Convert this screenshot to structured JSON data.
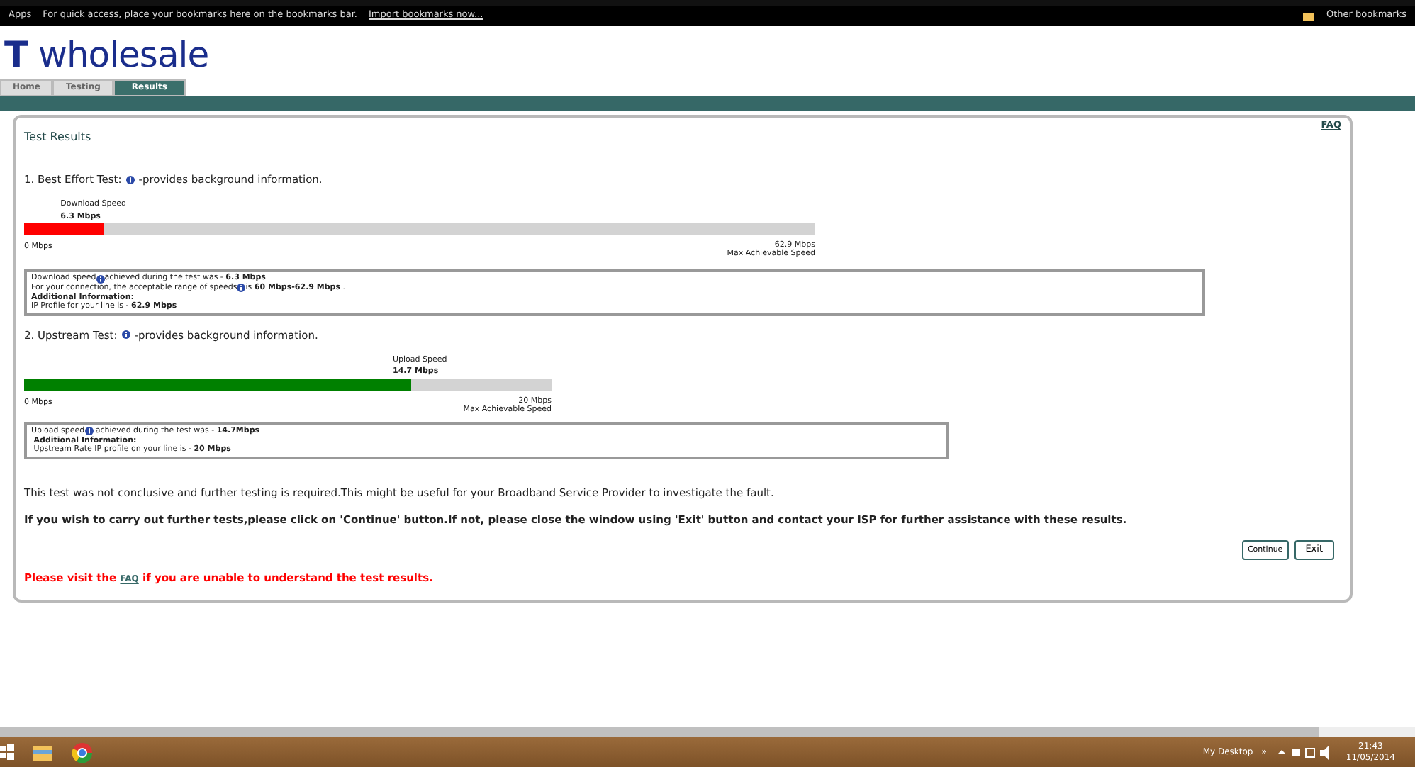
{
  "bookmarks_bar": {
    "apps": "Apps",
    "hint": "For quick access, place your bookmarks here on the bookmarks bar.",
    "import_link": "Import bookmarks now...",
    "other": "Other bookmarks"
  },
  "logo": {
    "text": "**T** wholesale"
  },
  "tabs": [
    {
      "label": "Home",
      "selected": false
    },
    {
      "label": "Testing",
      "selected": false
    },
    {
      "label": "Results",
      "selected": true
    }
  ],
  "panel": {
    "title": "Test Results",
    "faq_link": "FAQ",
    "tests": [
      {
        "heading": "1. Best Effort Test:",
        "info": "-provides background information.",
        "speed_label": "Download Speed",
        "speed": "6.3 Mbps",
        "level": 0.1,
        "color": "#ff0000",
        "min": "0 Mbps",
        "max": "62.9 Mbps",
        "max_label": "Max Achievable Speed",
        "details": [
          {
            "text": "Download speed",
            "rest": "achieved during the test was - **6.3 Mbps**"
          },
          {
            "text": "For your connection, the acceptable range of speeds",
            "rest": "is **60 Mbps-62.9 Mbps** ."
          },
          {
            "text": "**Additional Information:**"
          },
          {
            "text": "IP Profile for your line is - **62.9 Mbps**"
          }
        ]
      },
      {
        "heading": "2. Upstream Test:",
        "info": "-provides background information.",
        "speed_label": "Upload Speed",
        "speed": "14.7 Mbps",
        "level": 0.735,
        "color": "#008000",
        "min": "0 Mbps",
        "max": "20 Mbps",
        "max_label": "Max Achievable Speed",
        "details": [
          {
            "text": "Upload speed",
            "rest": " achieved during the test was - **14.7Mbps**"
          },
          {
            "text": " **Additional Information:**"
          },
          {
            "text": " Upstream Rate IP profile on your line is - **20 Mbps**"
          }
        ]
      }
    ],
    "note": "This test was not conclusive and further testing is required.This might be useful for your Broadband Service Provider to investigate the fault.",
    "instruction": "If you wish to carry out further tests,please click on 'Continue' button.If not, please close the window using 'Exit' button and contact your ISP for further assistance with these results.",
    "buttons": [
      "Continue",
      "Exit"
    ],
    "help_before": "Please visit the",
    "help_link": "FAQ",
    "help_after": "if you are unable to understand the test results."
  },
  "taskbar": {
    "desktop": "My Desktop",
    "chevron": "»",
    "time": "21:43",
    "date": "11/05/2014"
  }
}
